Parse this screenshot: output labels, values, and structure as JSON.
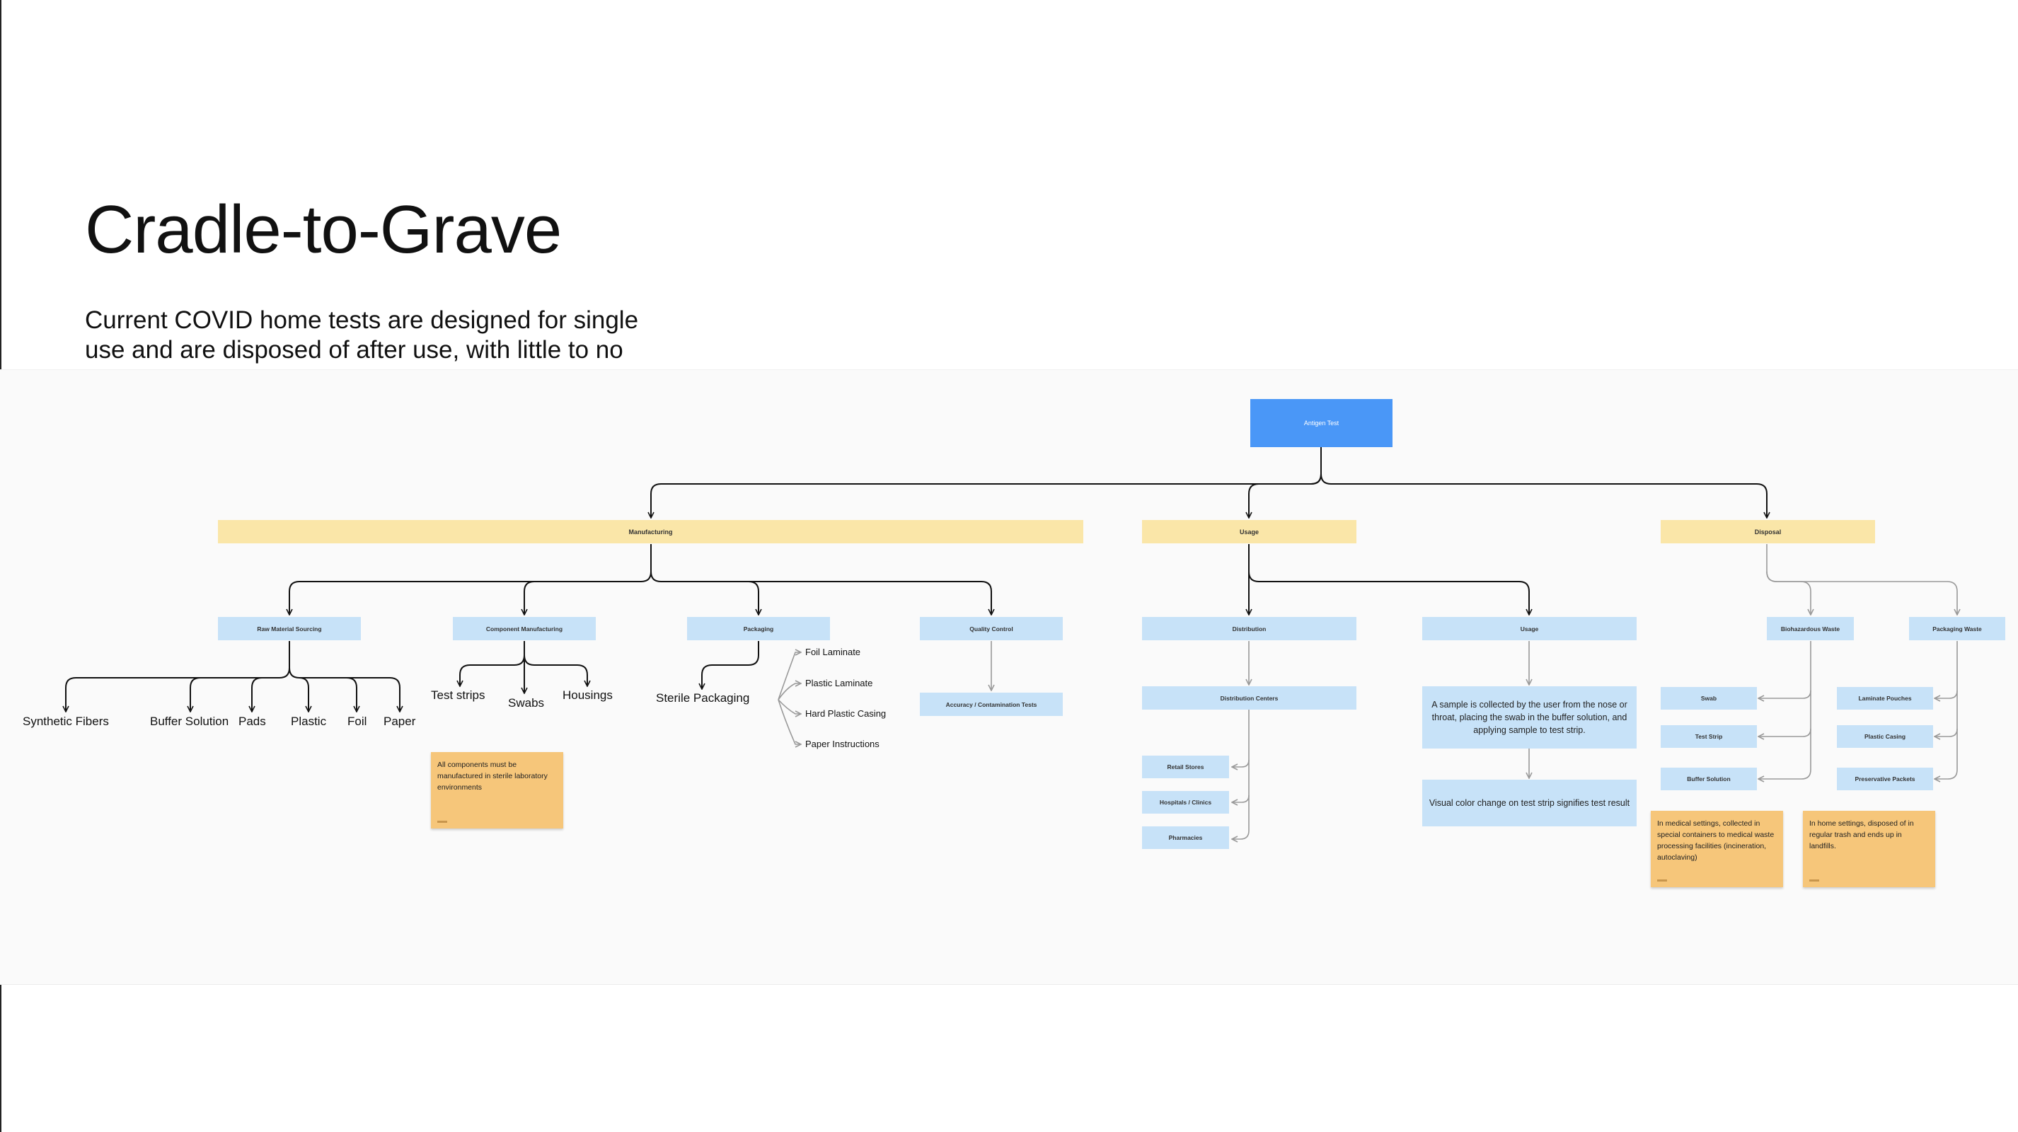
{
  "page": {
    "title": "Cradle-to-Grave",
    "subtitle": "Current COVID home tests are designed for single use and are disposed of after use, with little to no ability to recycle or reuse components."
  },
  "diagram": {
    "root": "Antigen Test",
    "phases": {
      "manufacturing": "Manufacturing",
      "usage": "Usage",
      "disposal": "Disposal"
    },
    "manufacturing": {
      "raw_material_sourcing": "Raw Material Sourcing",
      "component_manufacturing": "Component Manufacturing",
      "packaging": "Packaging",
      "quality_control": "Quality Control",
      "raw_materials": [
        "Synthetic Fibers",
        "Buffer Solution",
        "Pads",
        "Plastic",
        "Foil",
        "Paper"
      ],
      "components": [
        "Test strips",
        "Swabs",
        "Housings"
      ],
      "sterile_packaging": "Sterile Packaging",
      "packaging_materials": [
        "Foil Laminate",
        "Plastic Laminate",
        "Hard Plastic Casing",
        "Paper Instructions"
      ],
      "qc_test": "Accuracy / Contamination Tests",
      "sticky_note": "All components must be manufactured in sterile laboratory environments"
    },
    "usage": {
      "distribution": "Distribution",
      "usage": "Usage",
      "distribution_centers": "Distribution Centers",
      "outlets": [
        "Retail Stores",
        "Hospitals / Clinics",
        "Pharmacies"
      ],
      "step1": "A sample is collected by the user from the nose or throat, placing the swab in the buffer solution, and applying sample to test strip.",
      "step2": "Visual color change on test strip signifies test result"
    },
    "disposal": {
      "biohazardous_waste": "Biohazardous Waste",
      "packaging_waste": "Packaging Waste",
      "biohazard_items": [
        "Swab",
        "Test Strip",
        "Buffer Solution"
      ],
      "packaging_items": [
        "Laminate Pouches",
        "Plastic Casing",
        "Preservative Packets"
      ],
      "sticky_medical": "In medical settings, collected in special containers to medical waste processing facilities (incineration, autoclaving)",
      "sticky_home": "In home settings, disposed of in regular trash and ends up in landfills."
    },
    "colors": {
      "root": "#4a97f7",
      "phase": "#fae6a8",
      "node": "#c7e2f8",
      "sticky": "#f6c67a"
    }
  }
}
